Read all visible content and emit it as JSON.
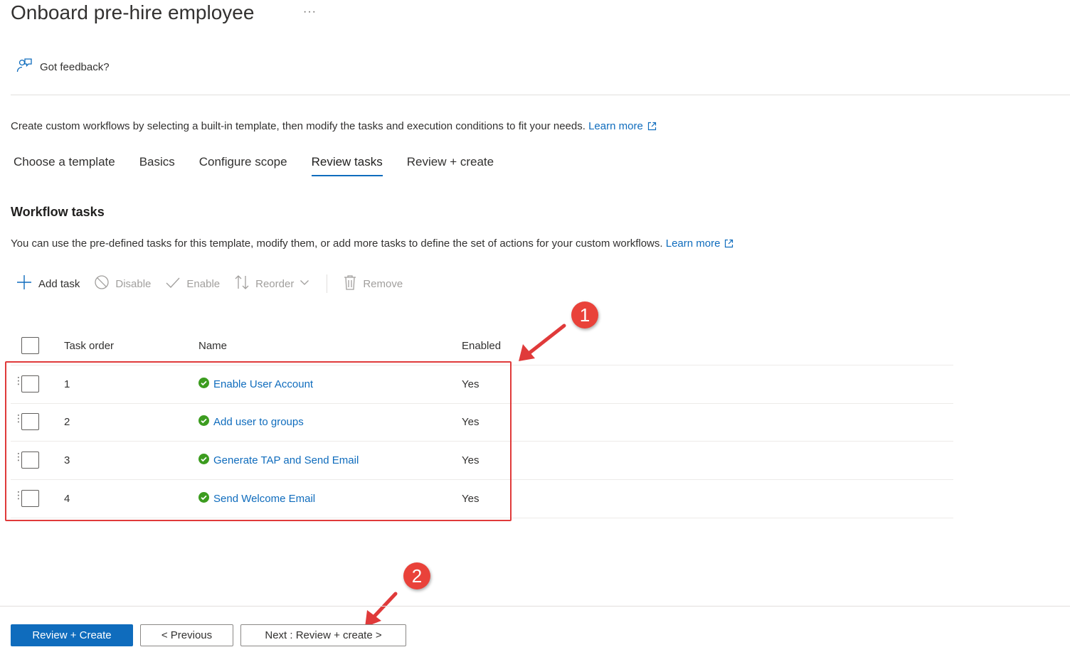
{
  "page": {
    "title": "Onboard pre-hire employee",
    "more_label": "···",
    "feedback_label": "Got feedback?",
    "intro_text": "Create custom workflows by selecting a built-in template, then modify the tasks and execution conditions to fit your needs.",
    "intro_link": "Learn more"
  },
  "tabs": [
    {
      "label": "Choose a template",
      "active": false
    },
    {
      "label": "Basics",
      "active": false
    },
    {
      "label": "Configure scope",
      "active": false
    },
    {
      "label": "Review tasks",
      "active": true
    },
    {
      "label": "Review + create",
      "active": false
    }
  ],
  "section": {
    "title": "Workflow tasks",
    "description": "You can use the pre-defined tasks for this template, modify them, or add more tasks to define the set of actions for your custom workflows.",
    "link": "Learn more"
  },
  "toolbar": {
    "add_task": "Add task",
    "disable": "Disable",
    "enable": "Enable",
    "reorder": "Reorder",
    "remove": "Remove"
  },
  "table": {
    "headers": {
      "order": "Task order",
      "name": "Name",
      "enabled": "Enabled"
    },
    "rows": [
      {
        "order": "1",
        "name": "Enable User Account",
        "enabled": "Yes"
      },
      {
        "order": "2",
        "name": "Add user to groups",
        "enabled": "Yes"
      },
      {
        "order": "3",
        "name": "Generate TAP and Send Email",
        "enabled": "Yes"
      },
      {
        "order": "4",
        "name": "Send Welcome Email",
        "enabled": "Yes"
      }
    ]
  },
  "annotations": {
    "badge1": "1",
    "badge2": "2"
  },
  "footer": {
    "review_create": "Review + Create",
    "previous": "< Previous",
    "next": "Next : Review + create >"
  },
  "colors": {
    "accent": "#0f6cbd",
    "success": "#3c9c1f",
    "annotation_red": "#e03a3a"
  }
}
